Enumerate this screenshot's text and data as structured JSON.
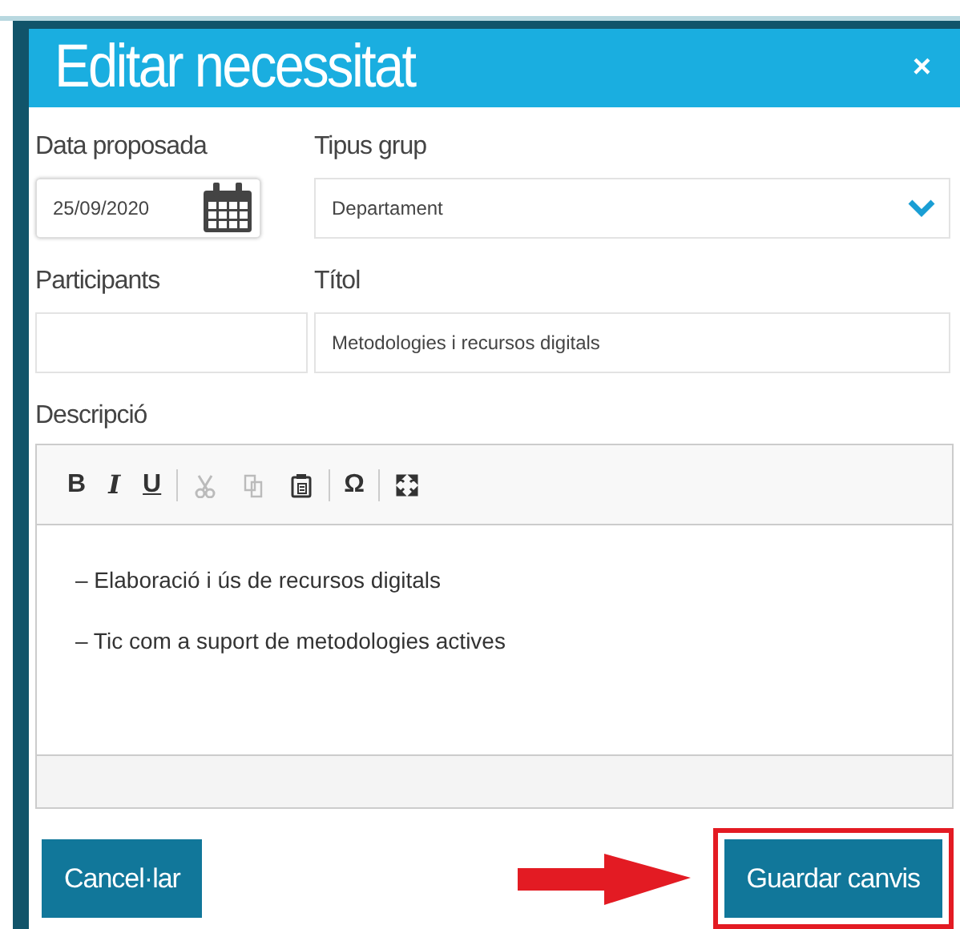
{
  "dialog": {
    "title": "Editar necessitat",
    "close": "×"
  },
  "fields": {
    "date": {
      "label": "Data proposada",
      "value": "25/09/2020"
    },
    "group_type": {
      "label": "Tipus grup",
      "value": "Departament"
    },
    "participants": {
      "label": "Participants"
    },
    "title": {
      "label": "Títol",
      "value": "Metodologies i recursos digitals"
    }
  },
  "description": {
    "label": "Descripció",
    "toolbar": [
      {
        "kind": "glyph",
        "label": "B",
        "disabled": false
      },
      {
        "kind": "glyph",
        "label": "I",
        "disabled": false
      },
      {
        "kind": "glyph",
        "label": "U",
        "disabled": false
      },
      {
        "kind": "separator"
      },
      {
        "kind": "icon",
        "disabled": true
      },
      {
        "kind": "icon",
        "disabled": true
      },
      {
        "kind": "icon",
        "disabled": false
      },
      {
        "kind": "separator"
      },
      {
        "kind": "glyph",
        "label": "Ω",
        "disabled": false
      },
      {
        "kind": "separator"
      },
      {
        "kind": "icon",
        "disabled": false
      }
    ],
    "lines": [
      "– Elaboració i ús de recursos digitals",
      "– Tic com a suport de metodologies actives"
    ]
  },
  "buttons": [
    {
      "label": "Cancel·lar",
      "highlighted": false
    },
    {
      "label": "Guardar canvis",
      "highlighted": true
    }
  ]
}
